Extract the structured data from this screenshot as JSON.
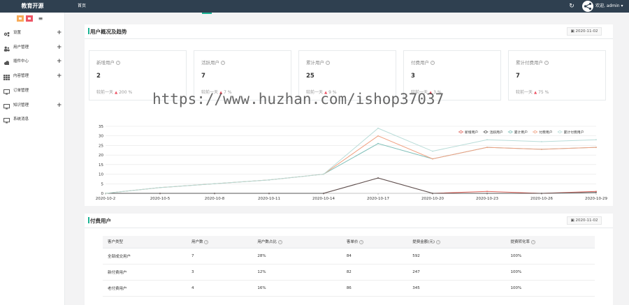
{
  "topbar": {
    "brand": "教育开源",
    "home": "首页",
    "user_menu": "欢迎, admin ▾",
    "bg_color": "#2f4050"
  },
  "sidebar": {
    "items": [
      {
        "label": "设置",
        "icon": "gears-icon",
        "expandable": true
      },
      {
        "label": "用户管理",
        "icon": "users-icon",
        "expandable": true
      },
      {
        "label": "插件中心",
        "icon": "cloud-icon",
        "expandable": true
      },
      {
        "label": "内容管理",
        "icon": "grid-icon",
        "expandable": true
      },
      {
        "label": "订单管理",
        "icon": "monitor-icon",
        "expandable": false
      },
      {
        "label": "知识管理",
        "icon": "monitor-icon",
        "expandable": true
      },
      {
        "label": "系统消息",
        "icon": "monitor-icon",
        "expandable": false
      }
    ]
  },
  "overview": {
    "title": "用户概况及趋势",
    "date": "2020-11-02",
    "compare_label": "较前一天",
    "cards": [
      {
        "title": "新增用户",
        "value": "2",
        "delta": "200 %"
      },
      {
        "title": "活跃用户",
        "value": "7",
        "delta": "7 %"
      },
      {
        "title": "累计用户",
        "value": "25",
        "delta": "9 %"
      },
      {
        "title": "付费用户",
        "value": "3",
        "delta": "3 %"
      },
      {
        "title": "累计付费用户",
        "value": "7",
        "delta": "75 %"
      }
    ]
  },
  "chart_data": {
    "type": "line",
    "x": [
      "2020-10-2",
      "2020-10-5",
      "2020-10-8",
      "2020-10-11",
      "2020-10-14",
      "2020-10-17",
      "2020-10-20",
      "2020-10-23",
      "2020-10-26",
      "2020-10-29"
    ],
    "ylim": [
      0,
      35
    ],
    "yticks": [
      0,
      5,
      10,
      15,
      20,
      25,
      30,
      35
    ],
    "series": [
      {
        "name": "新增用户",
        "color": "#e0675f",
        "values": [
          0,
          0,
          0,
          0,
          0,
          8,
          0,
          1,
          0,
          1
        ]
      },
      {
        "name": "活跃用户",
        "color": "#555555",
        "values": [
          0,
          0,
          0,
          0,
          0,
          8,
          0,
          0,
          0,
          0.5
        ]
      },
      {
        "name": "累计用户",
        "color": "#7fbfb8",
        "values": [
          0,
          3,
          5,
          7,
          10,
          26,
          18,
          24,
          23,
          24
        ]
      },
      {
        "name": "付费用户",
        "color": "#f0a080",
        "values": [
          0,
          3,
          5,
          7,
          10,
          30,
          18,
          24,
          23,
          24
        ]
      },
      {
        "name": "累计付费用户",
        "color": "#b8dcd8",
        "values": [
          0,
          3,
          5,
          7,
          10,
          34,
          22,
          28,
          27,
          28
        ]
      }
    ],
    "legend_position": "top-right",
    "grid": true
  },
  "paid": {
    "title": "付费用户",
    "date": "2020-11-02",
    "headers": [
      "客户类型",
      "用户数",
      "用户数占比",
      "客单价",
      "提费金额(元)",
      "提费转化率"
    ],
    "help_columns": [
      false,
      true,
      true,
      true,
      true,
      true
    ],
    "rows": [
      [
        "全部成交用户",
        "7",
        "28%",
        "84",
        "592",
        "100%"
      ],
      [
        "新付费用户",
        "3",
        "12%",
        "82",
        "247",
        "100%"
      ],
      [
        "老付费用户",
        "4",
        "16%",
        "86",
        "345",
        "100%"
      ]
    ]
  },
  "watermark": "https://www.huzhan.com/ishop37037"
}
